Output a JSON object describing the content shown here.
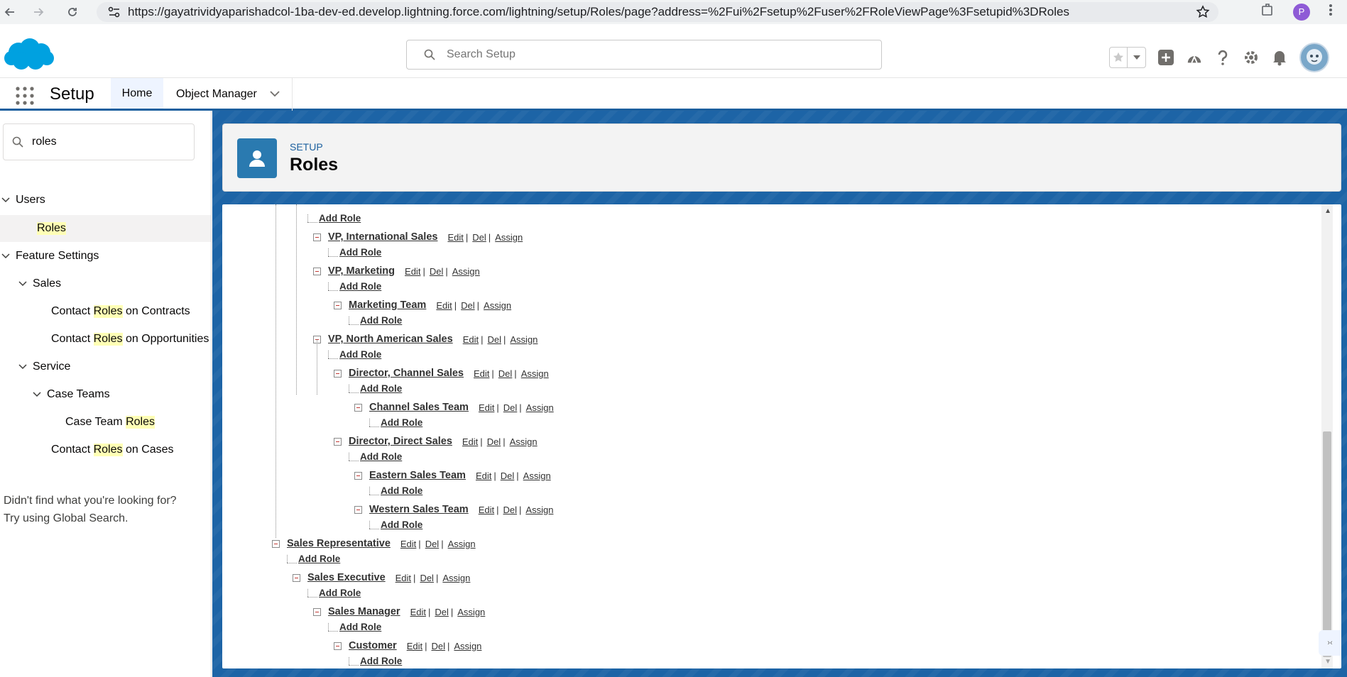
{
  "browser": {
    "url": "https://gayatrividyaparishadcol-1ba-dev-ed.develop.lightning.force.com/lightning/setup/Roles/page?address=%2Fui%2Fsetup%2Fuser%2FRoleViewPage%3Fsetupid%3DRoles",
    "profile_initial": "P"
  },
  "header": {
    "search_placeholder": "Search Setup"
  },
  "appnav": {
    "app_name": "Setup",
    "tabs": [
      {
        "label": "Home"
      },
      {
        "label": "Object Manager"
      }
    ]
  },
  "sidebar": {
    "quickfind_value": "roles",
    "users_label": "Users",
    "roles_label": "Roles",
    "feature_settings_label": "Feature Settings",
    "sales_label": "Sales",
    "contracts": {
      "pre": "Contact ",
      "hl": "Roles",
      "post": " on Contracts"
    },
    "opportunities": {
      "pre": "Contact ",
      "hl": "Roles",
      "post": " on Opportunities"
    },
    "service_label": "Service",
    "case_teams_label": "Case Teams",
    "case_team_roles": {
      "pre": "Case Team ",
      "hl": "Roles"
    },
    "cases": {
      "pre": "Contact ",
      "hl": "Roles",
      "post": " on Cases"
    },
    "not_found_1": "Didn't find what you're looking for?",
    "not_found_2": "Try using Global Search."
  },
  "page_header": {
    "eyebrow": "SETUP",
    "title": "Roles"
  },
  "actions": {
    "edit": "Edit",
    "del": "Del",
    "assign": "Assign",
    "sep": "|",
    "add_role": "Add Role"
  },
  "roles": [
    {
      "name": "VP, International Sales",
      "depth": 2
    },
    {
      "name": "VP, Marketing",
      "depth": 2
    },
    {
      "name": "Marketing Team",
      "depth": 3
    },
    {
      "name": "VP, North American Sales",
      "depth": 2
    },
    {
      "name": "Director, Channel Sales",
      "depth": 3
    },
    {
      "name": "Channel Sales Team",
      "depth": 4
    },
    {
      "name": "Director, Direct Sales",
      "depth": 3
    },
    {
      "name": "Eastern Sales Team",
      "depth": 4
    },
    {
      "name": "Western Sales Team",
      "depth": 4
    },
    {
      "name": "Sales Representative",
      "depth": 0
    },
    {
      "name": "Sales Executive",
      "depth": 1
    },
    {
      "name": "Sales Manager",
      "depth": 2
    },
    {
      "name": "Customer",
      "depth": 3
    }
  ]
}
